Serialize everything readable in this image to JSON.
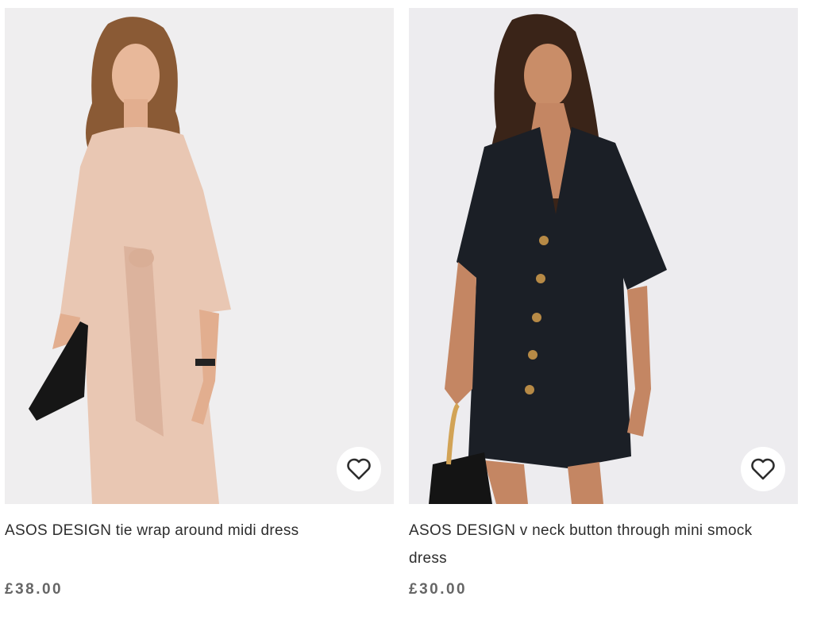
{
  "products": [
    {
      "title": "ASOS DESIGN tie wrap around midi dress",
      "price": "£38.00",
      "image_alt": "Woman wearing a blush pink tie wrap midi dress holding a black clutch",
      "dress_color": "#e9c7b3",
      "favourite_icon": "heart-outline-icon"
    },
    {
      "title": "ASOS DESIGN v neck button through mini smock dress",
      "price": "£30.00",
      "image_alt": "Woman wearing a black v neck button through mini smock dress holding a black bag",
      "dress_color": "#1b1f26",
      "favourite_icon": "heart-outline-icon"
    }
  ]
}
